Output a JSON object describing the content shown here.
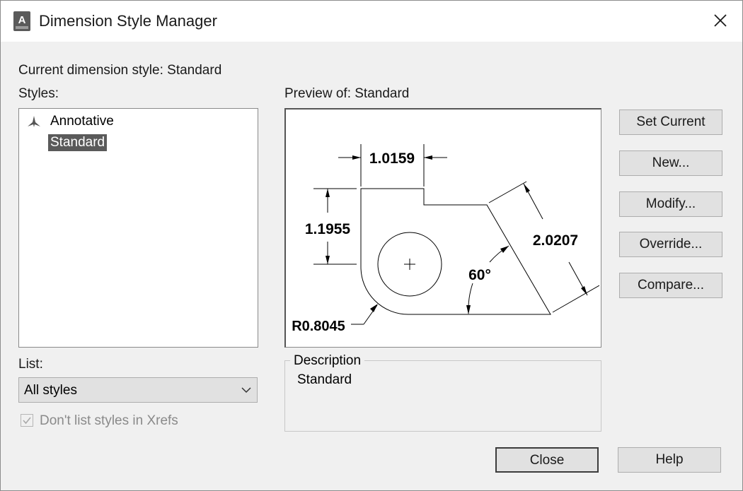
{
  "window": {
    "title": "Dimension Style Manager",
    "app_icon": "autocad-app-icon",
    "app_icon_letter": "A"
  },
  "current_style_label": "Current dimension style: Standard",
  "styles": {
    "label": "Styles:",
    "items": [
      {
        "label": "Annotative",
        "icon": "annotative-icon",
        "selected": false
      },
      {
        "label": "Standard",
        "selected": true
      }
    ]
  },
  "preview": {
    "label": "Preview of: Standard",
    "dimensions": {
      "top": "1.0159",
      "left": "1.1955",
      "diagonal": "2.0207",
      "angle": "60°",
      "radius": "R0.8045"
    }
  },
  "buttons": {
    "set_current": "Set Current",
    "new": "New...",
    "modify": "Modify...",
    "override": "Override...",
    "compare": "Compare...",
    "close": "Close",
    "help": "Help"
  },
  "list": {
    "label": "List:",
    "selected": "All styles"
  },
  "xref_checkbox": {
    "label": "Don't list styles in Xrefs",
    "checked": true,
    "enabled": false
  },
  "description": {
    "label": "Description",
    "value": "Standard"
  }
}
